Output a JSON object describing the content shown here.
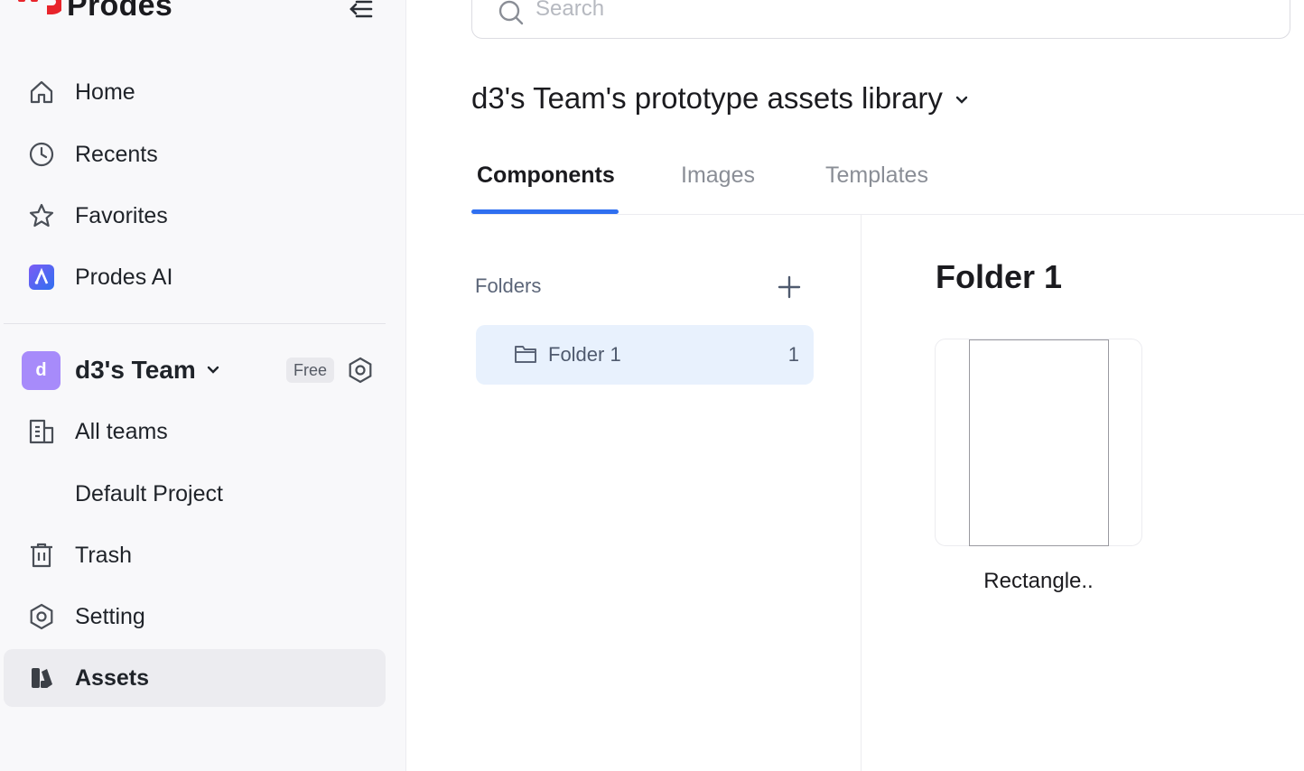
{
  "brand": {
    "name": "Prodes",
    "accent": "#e8242b"
  },
  "sidebar": {
    "items": [
      {
        "label": "Home",
        "icon": "home-icon"
      },
      {
        "label": "Recents",
        "icon": "clock-icon"
      },
      {
        "label": "Favorites",
        "icon": "star-icon"
      },
      {
        "label": "Prodes AI",
        "icon": "prodes-ai-icon"
      }
    ],
    "team": {
      "avatar_letter": "d",
      "name": "d3's Team",
      "plan": "Free"
    },
    "team_items": [
      {
        "label": "All teams",
        "icon": "building-icon"
      },
      {
        "label": "Default Project",
        "icon": ""
      },
      {
        "label": "Trash",
        "icon": "trash-icon"
      },
      {
        "label": "Setting",
        "icon": "gear-icon"
      },
      {
        "label": "Assets",
        "icon": "assets-icon",
        "active": true
      }
    ]
  },
  "search": {
    "placeholder": "Search",
    "value": ""
  },
  "library": {
    "title": "d3's Team's prototype assets library"
  },
  "tabs": [
    {
      "label": "Components",
      "active": true
    },
    {
      "label": "Images",
      "active": false
    },
    {
      "label": "Templates",
      "active": false
    }
  ],
  "folders": {
    "label": "Folders",
    "items": [
      {
        "name": "Folder 1",
        "count": "1"
      }
    ]
  },
  "detail": {
    "title": "Folder 1",
    "components": [
      {
        "name": "Rectangle.."
      }
    ]
  },
  "colors": {
    "tab_accent": "#2f6ff0",
    "selected_folder_bg": "#e8f1fd",
    "active_nav_bg": "#ececf0"
  }
}
